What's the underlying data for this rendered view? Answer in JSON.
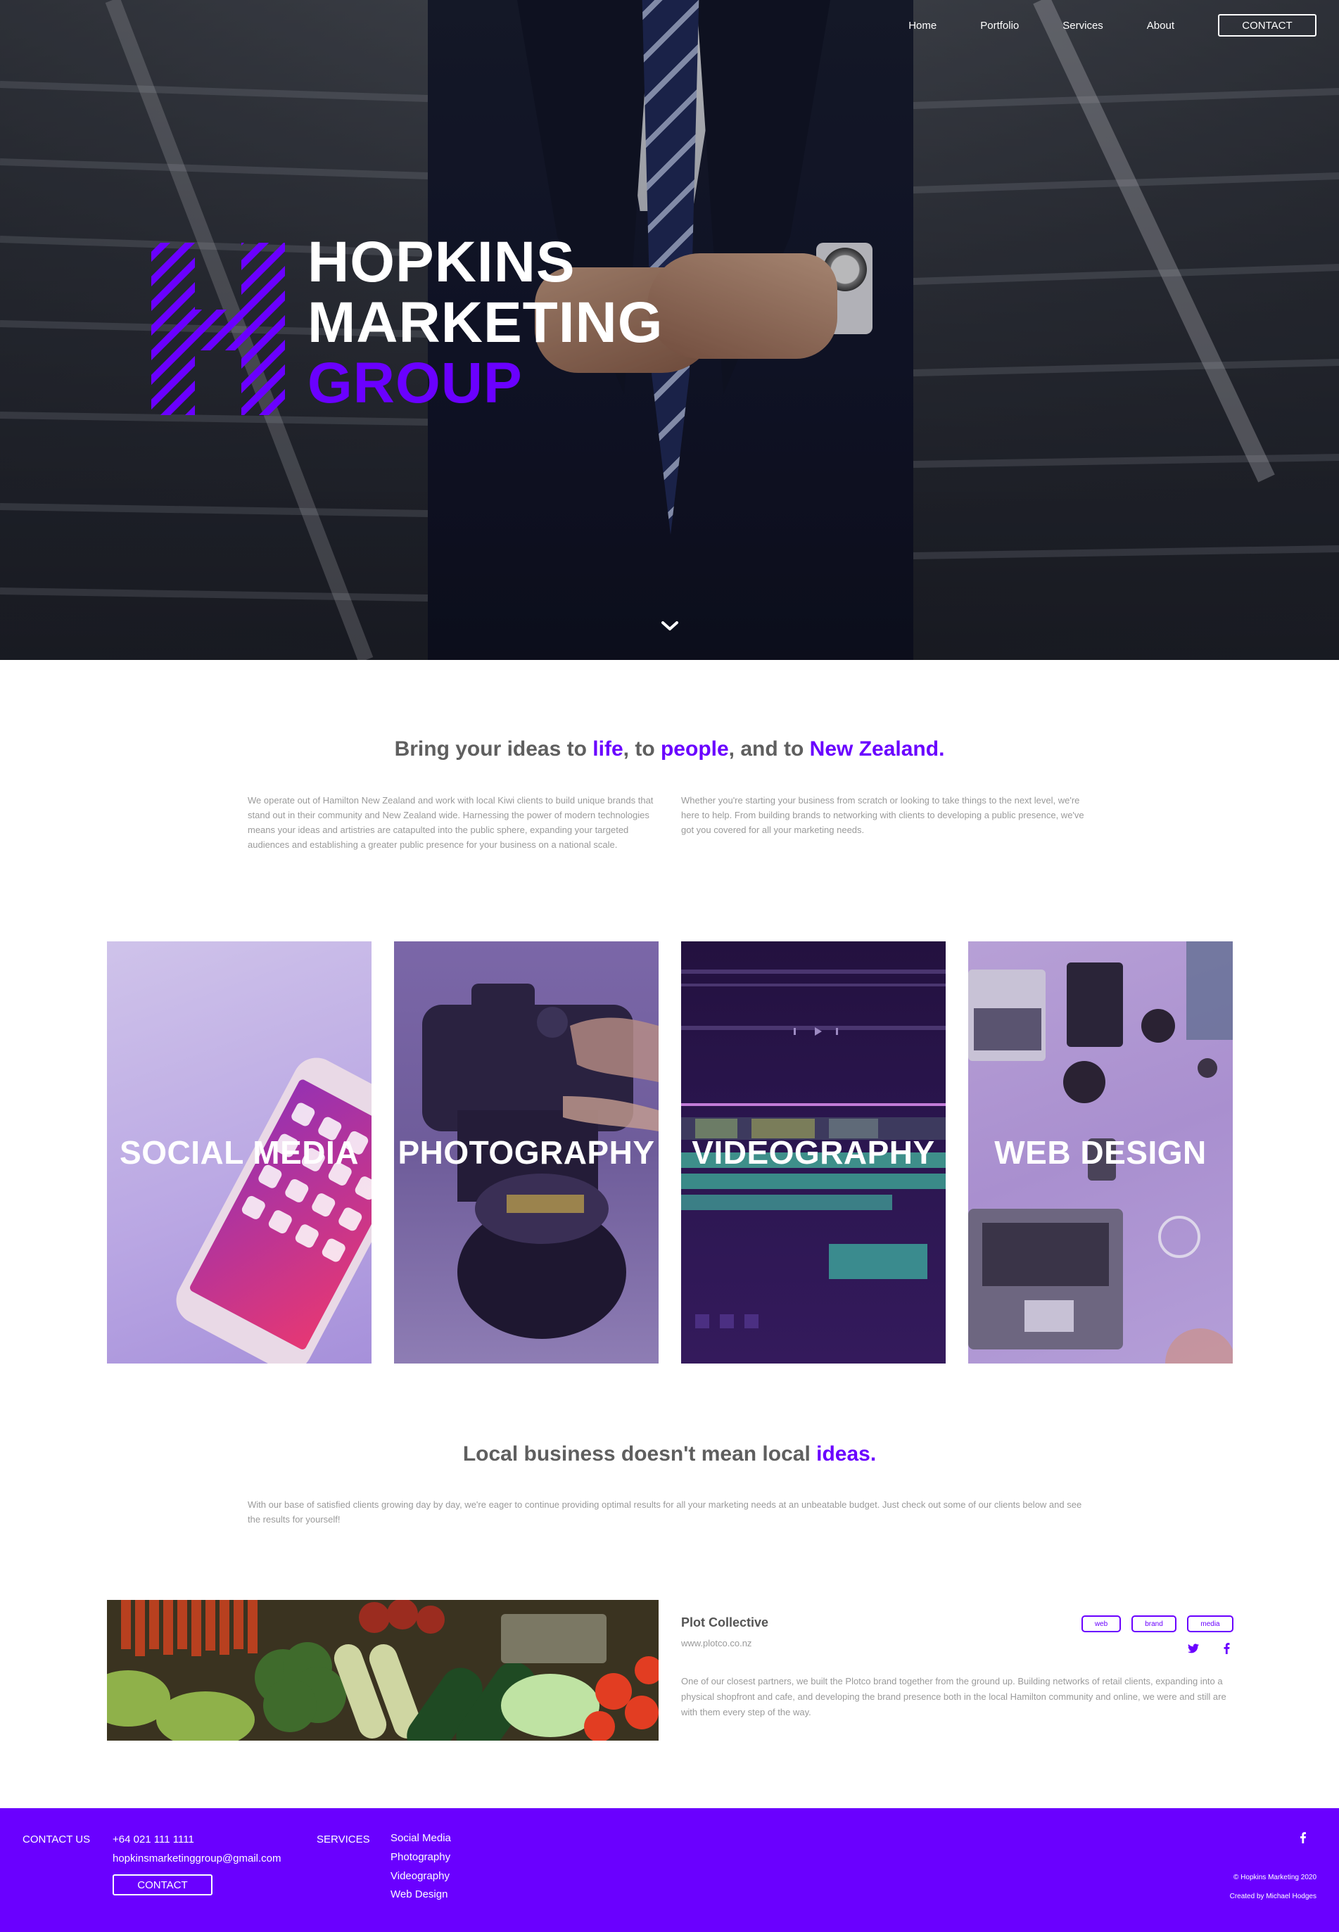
{
  "nav": {
    "items": [
      "Home",
      "Portfolio",
      "Services",
      "About"
    ],
    "contact_label": "CONTACT"
  },
  "hero": {
    "brand_line1": "HOPKINS",
    "brand_line2": "MARKETING",
    "brand_line3": "GROUP"
  },
  "intro": {
    "headline_pre": "Bring your ideas to ",
    "headline_w1": "life",
    "headline_mid1": ", to ",
    "headline_w2": "people",
    "headline_mid2": ", and to ",
    "headline_w3": "New Zealand",
    "headline_end": ".",
    "col_left": "We operate out of Hamilton New Zealand and work with local Kiwi clients to build unique brands that stand out in their community and New Zealand wide. Harnessing the power of modern technologies means your ideas and artistries are catapulted into the public sphere, expanding your targeted audiences and establishing a greater public presence for your business on a national scale.",
    "col_right": "Whether you're starting your business from scratch or looking to take things to the next level, we're here to help. From building brands to networking with clients to developing a public presence, we've got you covered for all your marketing needs."
  },
  "services": [
    {
      "label": "SOCIAL MEDIA"
    },
    {
      "label": "PHOTOGRAPHY"
    },
    {
      "label": "VIDEOGRAPHY"
    },
    {
      "label": "WEB DESIGN"
    }
  ],
  "local": {
    "headline_pre": "Local business doesn't mean local ",
    "headline_hl": "ideas",
    "headline_end": ".",
    "body": "With our base of satisfied clients growing day by day, we're eager to continue providing optimal results for all your marketing needs at an unbeatable budget. Just check out some of our clients below and see the results for yourself!"
  },
  "client": {
    "name": "Plot Collective",
    "url": "www.plotco.co.nz",
    "tags": [
      "web",
      "brand",
      "media"
    ],
    "social": [
      "twitter-icon",
      "facebook-icon"
    ],
    "description": "One of our closest partners, we built the Plotco brand together from the ground up. Building networks of retail clients, expanding into a physical shopfront and cafe, and developing the brand presence both in the local Hamilton community and online, we were and still are with them every step of the way."
  },
  "footer": {
    "contact_heading": "CONTACT US",
    "phone": "+64 021 111 1111",
    "email": "hopkinsmarketinggroup@gmail.com",
    "contact_button": "CONTACT",
    "services_heading": "SERVICES",
    "services": [
      "Social Media",
      "Photography",
      "Videography",
      "Web Design"
    ],
    "copyright": "© Hopkins Marketing 2020",
    "credit": "Created by Michael Hodges"
  },
  "colors": {
    "accent": "#6a00ff",
    "text": "#6b6b6b",
    "muted": "#9a9a9a"
  }
}
